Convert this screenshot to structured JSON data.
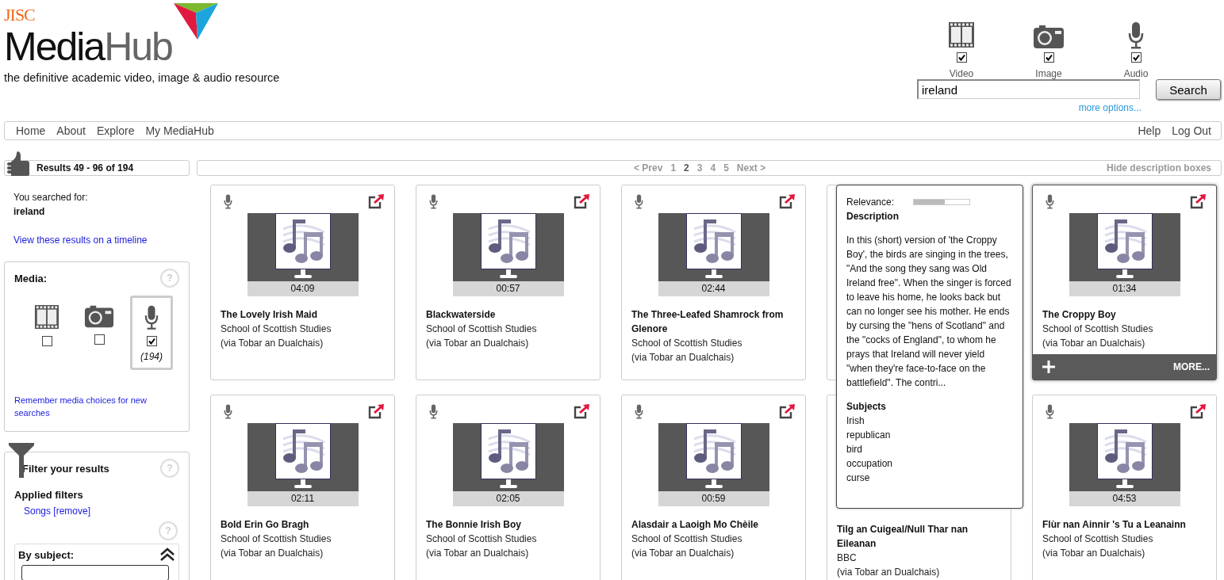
{
  "logo": {
    "org": "JISC",
    "name_dark": "Media",
    "name_light": "Hub",
    "tagline": "the definitive academic video, image & audio resource"
  },
  "search_media": [
    {
      "kind": "video",
      "label": "Video",
      "checked": true
    },
    {
      "kind": "image",
      "label": "Image",
      "checked": true
    },
    {
      "kind": "audio",
      "label": "Audio",
      "checked": true
    }
  ],
  "search": {
    "value": "ireland",
    "button": "Search",
    "more_options": "more options..."
  },
  "nav": {
    "left": [
      "Home",
      "About",
      "Explore",
      "My MediaHub"
    ],
    "right": [
      "Help",
      "Log Out"
    ]
  },
  "results_header": "Results 49 - 96 of 194",
  "searched": {
    "label": "You searched for:",
    "query": "ireland",
    "timeline_link": "View these results on a timeline"
  },
  "media_panel": {
    "title": "Media:",
    "help": "?",
    "options": [
      {
        "kind": "video",
        "checked": false,
        "selected": false
      },
      {
        "kind": "image",
        "checked": false,
        "selected": false
      },
      {
        "kind": "audio",
        "checked": true,
        "selected": true,
        "count": "(194)"
      }
    ],
    "remember_link": "Remember media choices for new searches"
  },
  "filter_panel": {
    "title": "Filter your results",
    "help": "?",
    "applied_title": "Applied filters",
    "applied": [
      "Songs [remove]"
    ],
    "help_2": "?",
    "subject_title": "By subject:"
  },
  "pagination": {
    "prev": "< Prev",
    "pages": [
      {
        "label": "1",
        "selected": false
      },
      {
        "label": "2",
        "selected": true
      },
      {
        "label": "3",
        "selected": false
      },
      {
        "label": "4",
        "selected": false
      },
      {
        "label": "5",
        "selected": false
      }
    ],
    "next": "Next >",
    "hide_descriptions": "Hide description boxes"
  },
  "results": [
    {
      "kind": "audio",
      "duration": "04:09",
      "title": "The Lovely Irish Maid",
      "source": "School of Scottish Studies",
      "via": "(via Tobar an Dualchais)"
    },
    {
      "kind": "audio",
      "duration": "00:57",
      "title": "Blackwaterside",
      "source": "School of Scottish Studies",
      "via": "(via Tobar an Dualchais)"
    },
    {
      "kind": "audio",
      "duration": "02:44",
      "title": "The Three-Leafed Shamrock from Glenore",
      "source": "School of Scottish Studies",
      "via": "(via Tobar an Dualchais)"
    },
    {
      "kind": "description",
      "relevance_label": "Relevance:",
      "level": 0.55,
      "heading": "Description",
      "text": "In this (short) version of 'the Croppy Boy', the birds are singing in the trees, \"And the song they sang was Old Ireland free\". When the singer is forced to leave his home, he looks back but can no longer see his mother. He ends by cursing the \"hens of Scotland\" and the \"cocks of England\", to whom he prays that Ireland will never yield \"when they're face-to-face on the battlefield\". The contri...",
      "subjects_heading": "Subjects",
      "subjects": [
        "Irish",
        "republican",
        "bird",
        "occupation",
        "curse"
      ]
    },
    {
      "kind": "audio",
      "duration": "01:34",
      "title": "The Croppy Boy",
      "source": "School of Scottish Studies",
      "via": "(via Tobar an Dualchais)",
      "hovered": true,
      "more_label": "MORE..."
    },
    {
      "kind": "audio",
      "duration": "02:11",
      "title": "Bold Erin Go Bragh",
      "source": "School of Scottish Studies",
      "via": "(via Tobar an Dualchais)"
    },
    {
      "kind": "audio",
      "duration": "02:05",
      "title": "The Bonnie Irish Boy",
      "source": "School of Scottish Studies",
      "via": "(via Tobar an Dualchais)"
    },
    {
      "kind": "audio",
      "duration": "00:59",
      "title": "Alasdair a Laoigh Mo Chèile",
      "source": "School of Scottish Studies",
      "via": "(via Tobar an Dualchais)"
    },
    {
      "kind": "covered",
      "title": "Tilg an Cuigeal/Null Thar nan Eileanan",
      "source": "BBC",
      "via": "(via Tobar an Dualchais)"
    },
    {
      "kind": "audio",
      "duration": "04:53",
      "title": "Flùr nan Ainnir 's Tu a Leanainn",
      "source": "School of Scottish Studies",
      "via": "(via Tobar an Dualchais)"
    }
  ]
}
